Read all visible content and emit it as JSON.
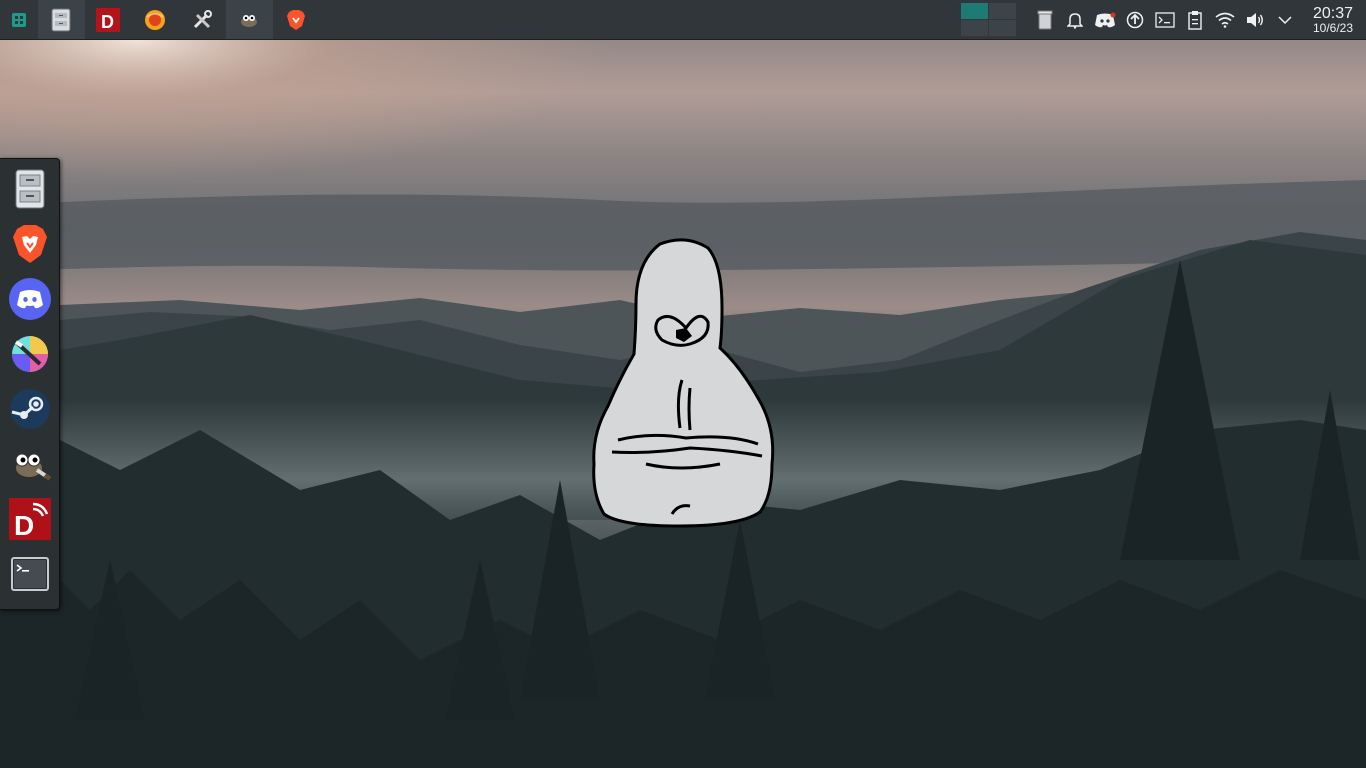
{
  "panel": {
    "tasks": [
      {
        "name": "app-launcher",
        "icon": "app-launcher-icon"
      },
      {
        "name": "file-manager",
        "icon": "file-cabinet-icon"
      },
      {
        "name": "davinci-resolve",
        "icon": "davinci-d-icon"
      },
      {
        "name": "firefox-like-browser",
        "icon": "orange-globe-icon"
      },
      {
        "name": "system-tools",
        "icon": "tools-icon"
      },
      {
        "name": "gimp",
        "icon": "gimp-icon"
      },
      {
        "name": "brave",
        "icon": "brave-lion-icon"
      }
    ],
    "tray": [
      "trash-icon",
      "notifications-bell-icon",
      "discord-icon",
      "update-icon",
      "terminal-icon",
      "clipboard-icon",
      "wifi-icon",
      "volume-icon",
      "chevron-down-icon"
    ],
    "clock": {
      "time": "20:37",
      "date": "10/6/23"
    }
  },
  "dock": {
    "items": [
      "file-manager-icon",
      "brave-icon",
      "discord-icon",
      "krita-icon",
      "steam-icon",
      "gimp-icon",
      "davinci-resolve-icon",
      "terminal-icon"
    ]
  },
  "colors": {
    "panel": "#31363b",
    "accent": "#1d7a74"
  }
}
